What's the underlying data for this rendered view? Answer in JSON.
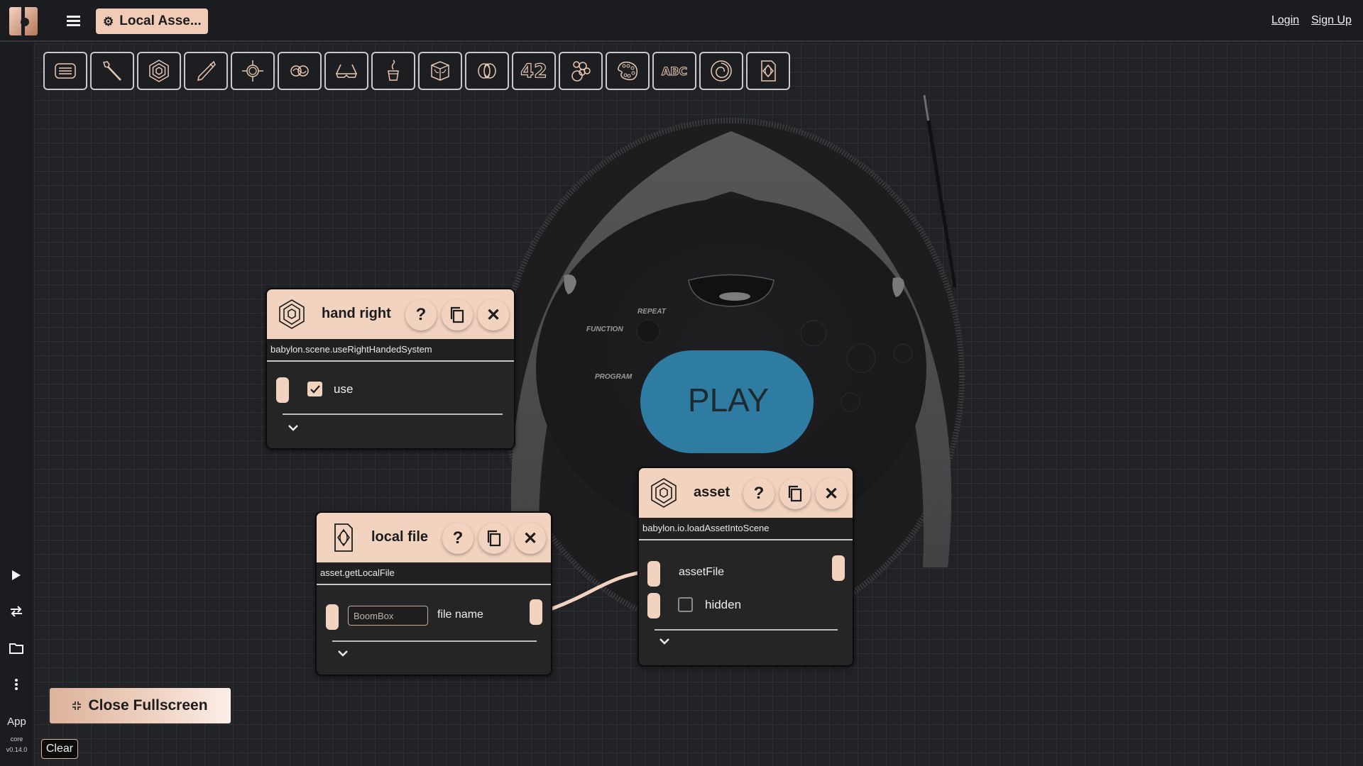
{
  "topbar": {
    "logo": "bitbybit-logo",
    "menu_icon": "hamburger-icon",
    "title": "Local Asse...",
    "title_icon": "gear-icon",
    "login": "Login",
    "signup": "Sign Up"
  },
  "toolbar": {
    "tools": [
      {
        "name": "input-tool",
        "icon": "keyboard-icon"
      },
      {
        "name": "brush-tool",
        "icon": "brush-icon"
      },
      {
        "name": "babylon-tool",
        "icon": "hexagon-icon"
      },
      {
        "name": "pen-tool",
        "icon": "pen-icon"
      },
      {
        "name": "target-tool",
        "icon": "crosshair-icon"
      },
      {
        "name": "infinity-tool",
        "icon": "infinity-icon"
      },
      {
        "name": "vr-tool",
        "icon": "glasses-icon"
      },
      {
        "name": "pot-tool",
        "icon": "pot-icon"
      },
      {
        "name": "cube-tool",
        "icon": "cube-icon"
      },
      {
        "name": "rings-tool",
        "icon": "rings-icon"
      },
      {
        "name": "number-tool",
        "icon": "number-icon",
        "label": "42"
      },
      {
        "name": "bubbles-tool",
        "icon": "bubbles-icon"
      },
      {
        "name": "palette-tool",
        "icon": "palette-icon"
      },
      {
        "name": "text-tool",
        "icon": "text-icon",
        "label": "ABC"
      },
      {
        "name": "spiral-tool",
        "icon": "spiral-icon"
      },
      {
        "name": "file-tool",
        "icon": "file-icon"
      }
    ]
  },
  "sidebar": {
    "play_icon": "play-icon",
    "swap_icon": "swap-icon",
    "folder_icon": "folder-icon",
    "more_icon": "more-vertical-icon",
    "app_label": "App",
    "core_label": "core",
    "version": "v0.14.0"
  },
  "scene": {
    "labels": [
      "REPEAT",
      "FUNCTION",
      "PROGRAM"
    ],
    "play_text": "PLAY",
    "play_color": "#2f7ca3"
  },
  "nodes": {
    "hand_right": {
      "title": "hand right",
      "subtitle": "babylon.scene.useRightHandedSystem",
      "input_label": "use",
      "use_checked": true
    },
    "local_file": {
      "title": "local file",
      "subtitle": "asset.getLocalFile",
      "input_value": "BoomBox",
      "input_label": "file name"
    },
    "asset": {
      "title": "asset",
      "subtitle": "babylon.io.loadAssetIntoScene",
      "input1_label": "assetFile",
      "input2_label": "hidden",
      "hidden_checked": false
    },
    "help_symbol": "?",
    "close_symbol": "✕"
  },
  "bottom": {
    "fullscreen_label": "Close Fullscreen",
    "clear_label": "Clear"
  },
  "colors": {
    "accent": "#f2d3c0",
    "background": "#212226",
    "topbar": "#1b1c1f"
  }
}
